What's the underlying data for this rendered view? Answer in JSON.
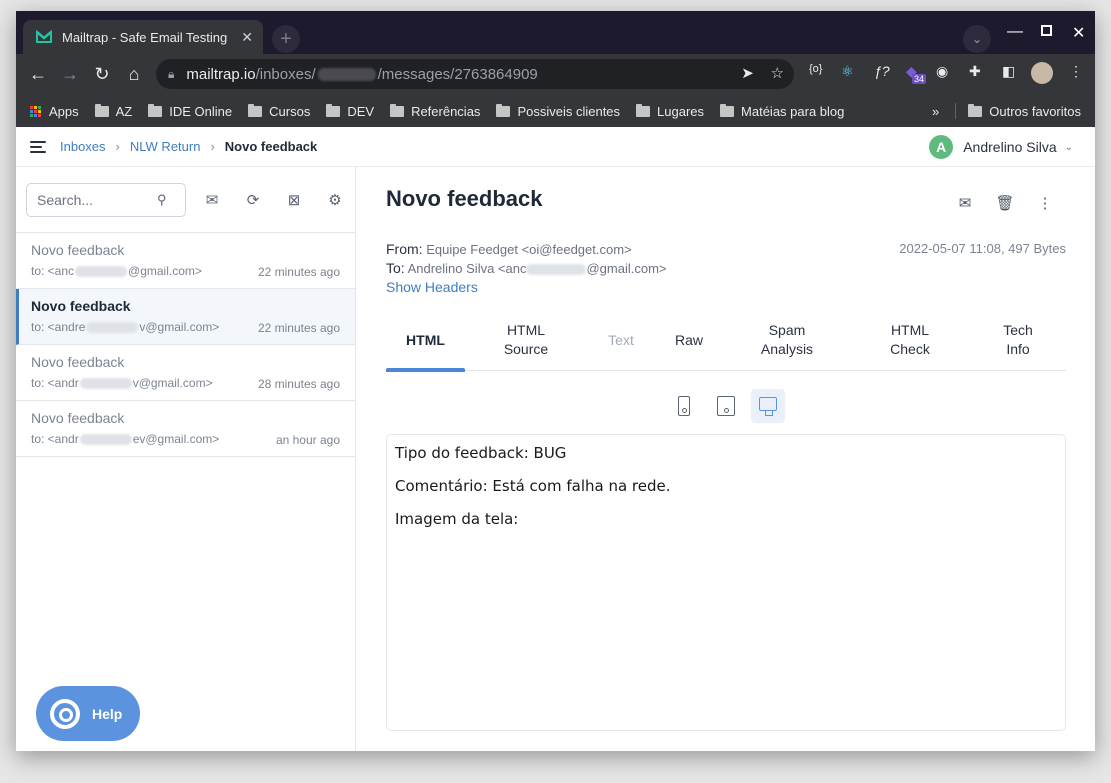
{
  "browser": {
    "tab_title": "Mailtrap - Safe Email Testing",
    "url_host": "mailtrap.io",
    "url_path_start": "/inboxes/",
    "url_path_end": "/messages/2763864909",
    "extension_badge": "34",
    "bookmarks": [
      "Apps",
      "AZ",
      "IDE Online",
      "Cursos",
      "DEV",
      "Referências",
      "Possiveis clientes",
      "Lugares",
      "Matéias para blog"
    ],
    "overflow": "»",
    "other_bookmarks": "Outros favoritos"
  },
  "header": {
    "breadcrumb": [
      "Inboxes",
      "NLW Return",
      "Novo feedback"
    ],
    "user_initial": "A",
    "user_name": "Andrelino Silva"
  },
  "sidebar": {
    "search_placeholder": "Search...",
    "messages": [
      {
        "subject": "Novo feedback",
        "to_prefix": "to: <anc",
        "to_suffix": "@gmail.com>",
        "time": "22 minutes ago",
        "active": false
      },
      {
        "subject": "Novo feedback",
        "to_prefix": "to: <andre",
        "to_suffix": "v@gmail.com>",
        "time": "22 minutes ago",
        "active": true
      },
      {
        "subject": "Novo feedback",
        "to_prefix": "to: <andr",
        "to_suffix": "v@gmail.com>",
        "time": "28 minutes ago",
        "active": false
      },
      {
        "subject": "Novo feedback",
        "to_prefix": "to: <andr",
        "to_suffix": "ev@gmail.com>",
        "time": "an hour ago",
        "active": false
      }
    ],
    "help_label": "Help"
  },
  "message": {
    "subject": "Novo feedback",
    "from_label": "From:",
    "from_value": "Equipe Feedget <oi@feedget.com>",
    "to_label": "To:",
    "to_prefix": "Andrelino Silva <anc",
    "to_suffix": "@gmail.com>",
    "date": "2022-05-07 11:08, 497 Bytes",
    "show_headers": "Show Headers",
    "tabs": [
      {
        "label": "HTML",
        "state": "active"
      },
      {
        "label": "HTML Source",
        "state": "normal"
      },
      {
        "label": "Text",
        "state": "disabled"
      },
      {
        "label": "Raw",
        "state": "normal"
      },
      {
        "label": "Spam Analysis",
        "state": "normal"
      },
      {
        "label": "HTML Check",
        "state": "normal"
      },
      {
        "label": "Tech Info",
        "state": "normal"
      }
    ],
    "body_lines": [
      "Tipo do feedback: BUG",
      "Comentário: Está com falha na rede.",
      "Imagem da tela:"
    ]
  },
  "colors": {
    "accent": "#3f7ec0",
    "help_button": "#5b93df",
    "avatar": "#5fba7d",
    "titlebar": "#1e1a2d"
  }
}
